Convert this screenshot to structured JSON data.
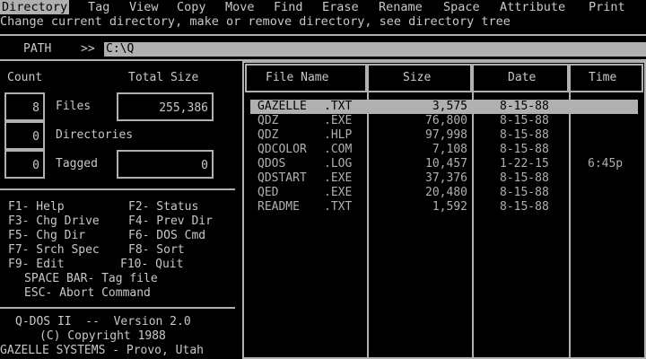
{
  "menu": {
    "items": [
      "Directory",
      "Tag",
      "View",
      "Copy",
      "Move",
      "Find",
      "Erase",
      "Rename",
      "Space",
      "Attribute",
      "Print"
    ],
    "active": "Directory",
    "description": "Change current directory, make or remove directory, see directory tree"
  },
  "path": {
    "label": "PATH",
    "arrows": ">>",
    "value": "C:\\Q"
  },
  "stats": {
    "count_header": "Count",
    "total_size_header": "Total Size",
    "files_count": "8",
    "files_label": "Files",
    "files_total_size": "255,386",
    "dirs_count": "0",
    "dirs_label": "Directories",
    "tagged_count": "0",
    "tagged_label": "Tagged",
    "tagged_total_size": "0"
  },
  "function_keys": [
    [
      "F1- Help",
      "F2- Status"
    ],
    [
      "F3- Chg Drive",
      "F4- Prev Dir"
    ],
    [
      "F5- Chg Dir",
      "F6- DOS Cmd"
    ],
    [
      "F7- Srch Spec",
      "F8- Sort"
    ],
    [
      "F9- Edit",
      "F10- Quit"
    ]
  ],
  "extra_keys": [
    "SPACE BAR- Tag file",
    "ESC- Abort Command"
  ],
  "footer": {
    "line1": "Q-DOS II  --  Version 2.0",
    "line2": "(C) Copyright 1988",
    "line3": "GAZELLE SYSTEMS - Provo, Utah"
  },
  "file_table": {
    "headers": {
      "name": "File Name",
      "size": "Size",
      "date": "Date",
      "time": "Time"
    },
    "rows": [
      {
        "name": "GAZELLE",
        "ext": ".TXT",
        "size": "3,575",
        "date": "8-15-88",
        "time": "",
        "selected": true
      },
      {
        "name": "QDZ",
        "ext": ".EXE",
        "size": "76,800",
        "date": "8-15-88",
        "time": "",
        "selected": false
      },
      {
        "name": "QDZ",
        "ext": ".HLP",
        "size": "97,998",
        "date": "8-15-88",
        "time": "",
        "selected": false
      },
      {
        "name": "QDCOLOR",
        "ext": ".COM",
        "size": "7,108",
        "date": "8-15-88",
        "time": "",
        "selected": false
      },
      {
        "name": "QDOS",
        "ext": ".LOG",
        "size": "10,457",
        "date": "1-22-15",
        "time": "6:45p",
        "selected": false
      },
      {
        "name": "QDSTART",
        "ext": ".EXE",
        "size": "37,376",
        "date": "8-15-88",
        "time": "",
        "selected": false
      },
      {
        "name": "QED",
        "ext": ".EXE",
        "size": "20,480",
        "date": "8-15-88",
        "time": "",
        "selected": false
      },
      {
        "name": "README",
        "ext": ".TXT",
        "size": "1,592",
        "date": "8-15-88",
        "time": "",
        "selected": false
      }
    ]
  },
  "colors": {
    "background": "#000000",
    "foreground": "#b0b0b0",
    "highlight": "#b0b0b0"
  }
}
